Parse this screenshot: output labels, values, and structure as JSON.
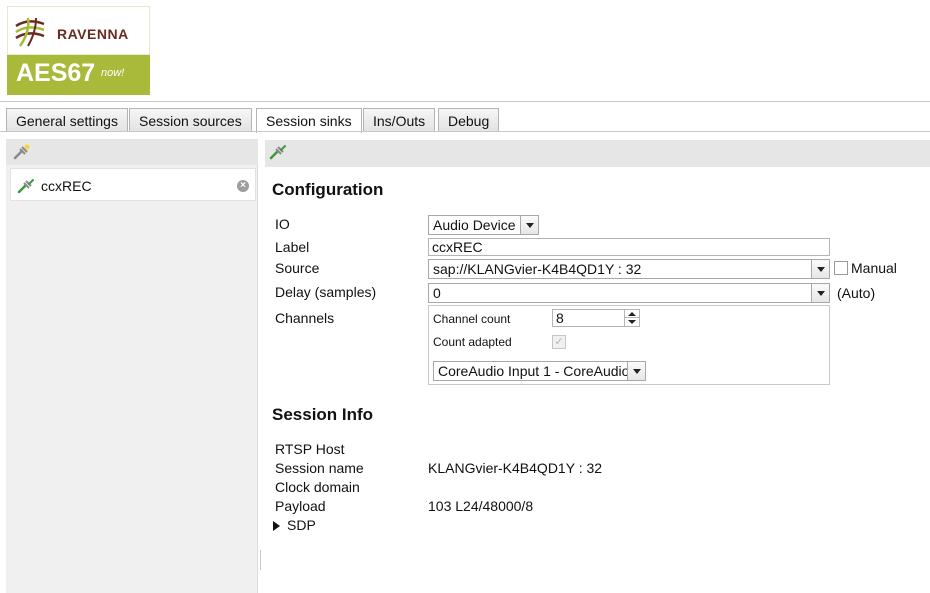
{
  "logo": {
    "brand": "RAVENNA",
    "product": "AES67",
    "tagline": "now!"
  },
  "tabs": [
    {
      "label": "General settings"
    },
    {
      "label": "Session sources"
    },
    {
      "label": "Session sinks",
      "active": true
    },
    {
      "label": "Ins/Outs"
    },
    {
      "label": "Debug"
    }
  ],
  "sidebar": {
    "toolbar_icon": "add-sink-icon",
    "items": [
      {
        "label": "ccxREC",
        "icon": "sink-connected-icon",
        "remove_icon": "remove-circle-icon"
      }
    ]
  },
  "main": {
    "toolbar_icon": "sink-connected-icon",
    "configuration": {
      "title": "Configuration",
      "io": {
        "label": "IO",
        "value": "Audio Device"
      },
      "label_field": {
        "label": "Label",
        "value": "ccxREC"
      },
      "source": {
        "label": "Source",
        "value": "sap://KLANGvier-K4B4QD1Y : 32",
        "manual_label": "Manual"
      },
      "delay": {
        "label": "Delay (samples)",
        "value": "0",
        "auto_label": "(Auto)"
      },
      "channels": {
        "label": "Channels",
        "count_label": "Channel count",
        "count_value": "8",
        "adapted_label": "Count adapted",
        "mapping_value": "CoreAudio Input 1 - CoreAudio"
      }
    },
    "session_info": {
      "title": "Session Info",
      "rtsp_host": {
        "label": "RTSP Host",
        "value": ""
      },
      "session_name": {
        "label": "Session name",
        "value": "KLANGvier-K4B4QD1Y : 32"
      },
      "clock_domain": {
        "label": "Clock domain",
        "value": ""
      },
      "payload": {
        "label": "Payload",
        "value": "103 L24/48000/8"
      },
      "sdp": {
        "label": "SDP"
      }
    }
  },
  "colors": {
    "brand_green": "#a9b93a",
    "brand_brown": "#6b2a1e",
    "connected_green": "#3a9a3a"
  }
}
